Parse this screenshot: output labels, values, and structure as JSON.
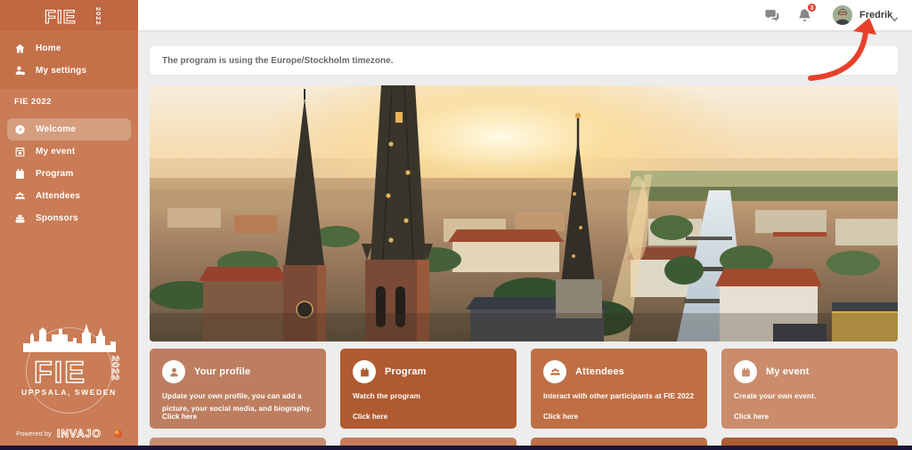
{
  "topbar": {
    "user_name": "Fredrik",
    "notification_count": "3"
  },
  "sidebar": {
    "logo": {
      "text": "FIE",
      "year": "2022"
    },
    "main_items": [
      {
        "label": "Home",
        "icon": "home-icon"
      },
      {
        "label": "My settings",
        "icon": "user-settings-icon"
      }
    ],
    "section_label": "FIE 2022",
    "event_items": [
      {
        "label": "Welcome",
        "icon": "gauge-icon",
        "active": true
      },
      {
        "label": "My event",
        "icon": "calendar-event-icon",
        "active": false
      },
      {
        "label": "Program",
        "icon": "clipboard-icon",
        "active": false
      },
      {
        "label": "Attendees",
        "icon": "people-icon",
        "active": false
      },
      {
        "label": "Sponsors",
        "icon": "register-icon",
        "active": false
      }
    ],
    "badge": {
      "text": "FIE",
      "year": "2022",
      "location": "UPPSALA, SWEDEN"
    },
    "footer": {
      "powered_by": "Powered by",
      "brand": "INVAJO"
    }
  },
  "notice": {
    "text": "The program is using the Europe/Stockholm timezone."
  },
  "cards": [
    {
      "title": "Your profile",
      "description": "Update your own profile, you can add a picture, your social media, and biography.",
      "link": "Click here",
      "color": "#bd7e60",
      "icon": "user-icon"
    },
    {
      "title": "Program",
      "description": "Watch the program",
      "link": "Click here",
      "color": "#b05a30",
      "icon": "calendar-icon"
    },
    {
      "title": "Attendees",
      "description": "Interact with other participants at FIE 2022",
      "link": "Click here",
      "color": "#c06f44",
      "icon": "people-icon"
    },
    {
      "title": "My event",
      "description": "Create your own event.",
      "link": "Click here",
      "color": "#ca8c6b",
      "icon": "calendar-icon"
    }
  ],
  "partial_row_colors": [
    "#c78e70",
    "#c57c58",
    "#bd6f46",
    "#ad5a31"
  ],
  "colors": {
    "sidebar": "#c97c55",
    "sidebar_header": "#bf6841",
    "sidebar_group": "#c4714a",
    "accent_red": "#e8402a",
    "badge_red": "#e23b2f",
    "bottom_strip": "#191538",
    "content_bg": "#ededed"
  }
}
